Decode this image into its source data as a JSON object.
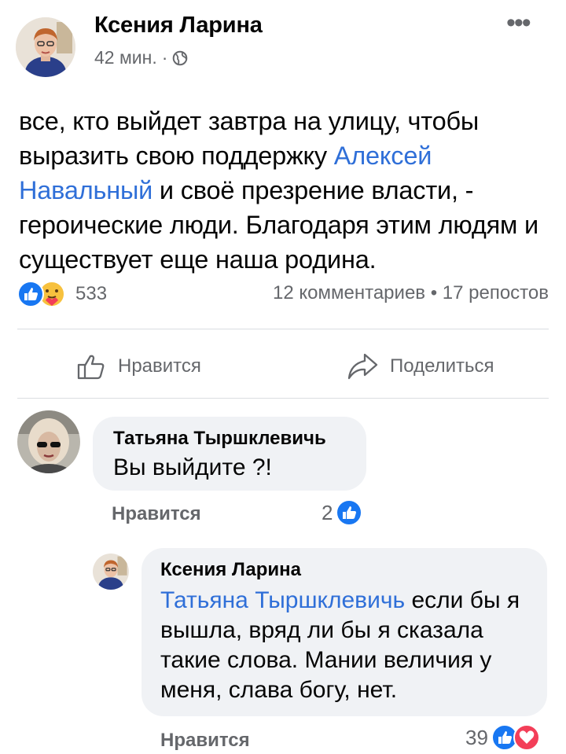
{
  "post": {
    "author": "Ксения Ларина",
    "time": "42 мин.",
    "separator": "·",
    "text_before": "все, кто выйдет завтра на улицу, чтобы выразить свою поддержку ",
    "mention": "Алексей Навальный",
    "text_after": " и своё презрение власти, - героические люди. Благодаря этим людям и существует еще наша родина.",
    "reactions_count": "533",
    "stats": "12 комментариев • 17 репостов"
  },
  "actions": {
    "like": "Нравится",
    "share": "Поделиться"
  },
  "comments": [
    {
      "author": "Татьяна Тыршклевичь",
      "text": "Вы выйдите ?!",
      "like": "Нравится",
      "count": "2"
    },
    {
      "author": "Ксения Ларина",
      "mention": "Татьяна Тыршклевичь",
      "text": " если бы я вышла, вряд ли бы я сказала такие слова. Мании величия у меня, слава богу, нет.",
      "like": "Нравится",
      "count": "39"
    }
  ],
  "colors": {
    "like_blue": "#1877f2",
    "love_red": "#f33e58",
    "mention": "#2f6fd8",
    "muted": "#65676b",
    "bubble": "#f0f2f5"
  },
  "icons": [
    "globe-icon",
    "more-icon",
    "like-reaction-icon",
    "care-reaction-icon",
    "love-reaction-icon",
    "thumbs-up-icon",
    "share-arrow-icon"
  ]
}
